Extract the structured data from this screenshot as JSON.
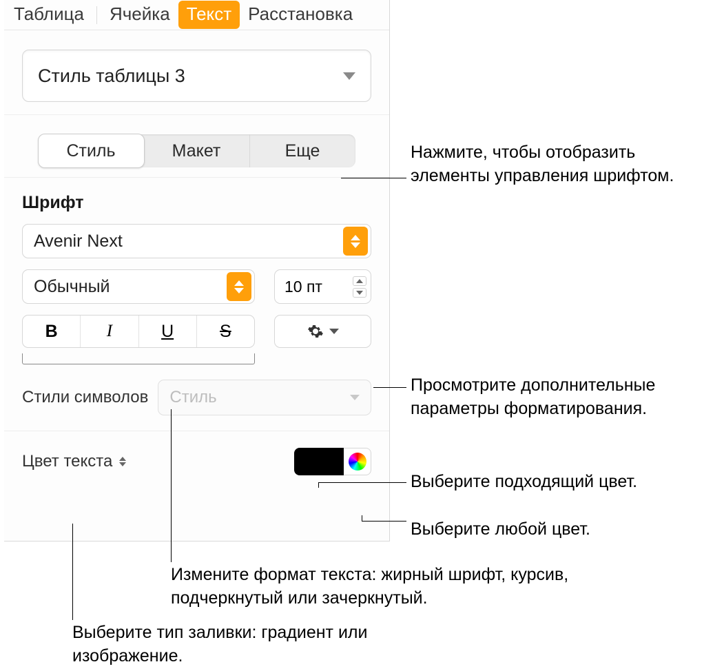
{
  "topTabs": {
    "table": "Таблица",
    "cell": "Ячейка",
    "text": "Текст",
    "arrange": "Расстановка"
  },
  "styleSelect": {
    "value": "Стиль таблицы 3"
  },
  "subTabs": {
    "style": "Стиль",
    "layout": "Макет",
    "more": "Еще"
  },
  "fontSection": {
    "title": "Шрифт",
    "family": "Avenir Next",
    "weight": "Обычный",
    "size": "10 пт",
    "bold": "B",
    "italic": "I",
    "underline": "U",
    "strike": "S"
  },
  "charStyle": {
    "label": "Стили символов",
    "placeholder": "Стиль"
  },
  "textColor": {
    "label": "Цвет текста",
    "swatch": "#000000"
  },
  "callouts": {
    "c1": "Нажмите, чтобы отобразить элементы управления шрифтом.",
    "c2": "Просмотрите дополнительные параметры форматирования.",
    "c3": "Выберите подходящий цвет.",
    "c4": "Выберите любой цвет.",
    "c5": "Измените формат текста: жирный шрифт, курсив, подчеркнутый или зачеркнутый.",
    "c6": "Выберите тип заливки: градиент или изображение."
  }
}
